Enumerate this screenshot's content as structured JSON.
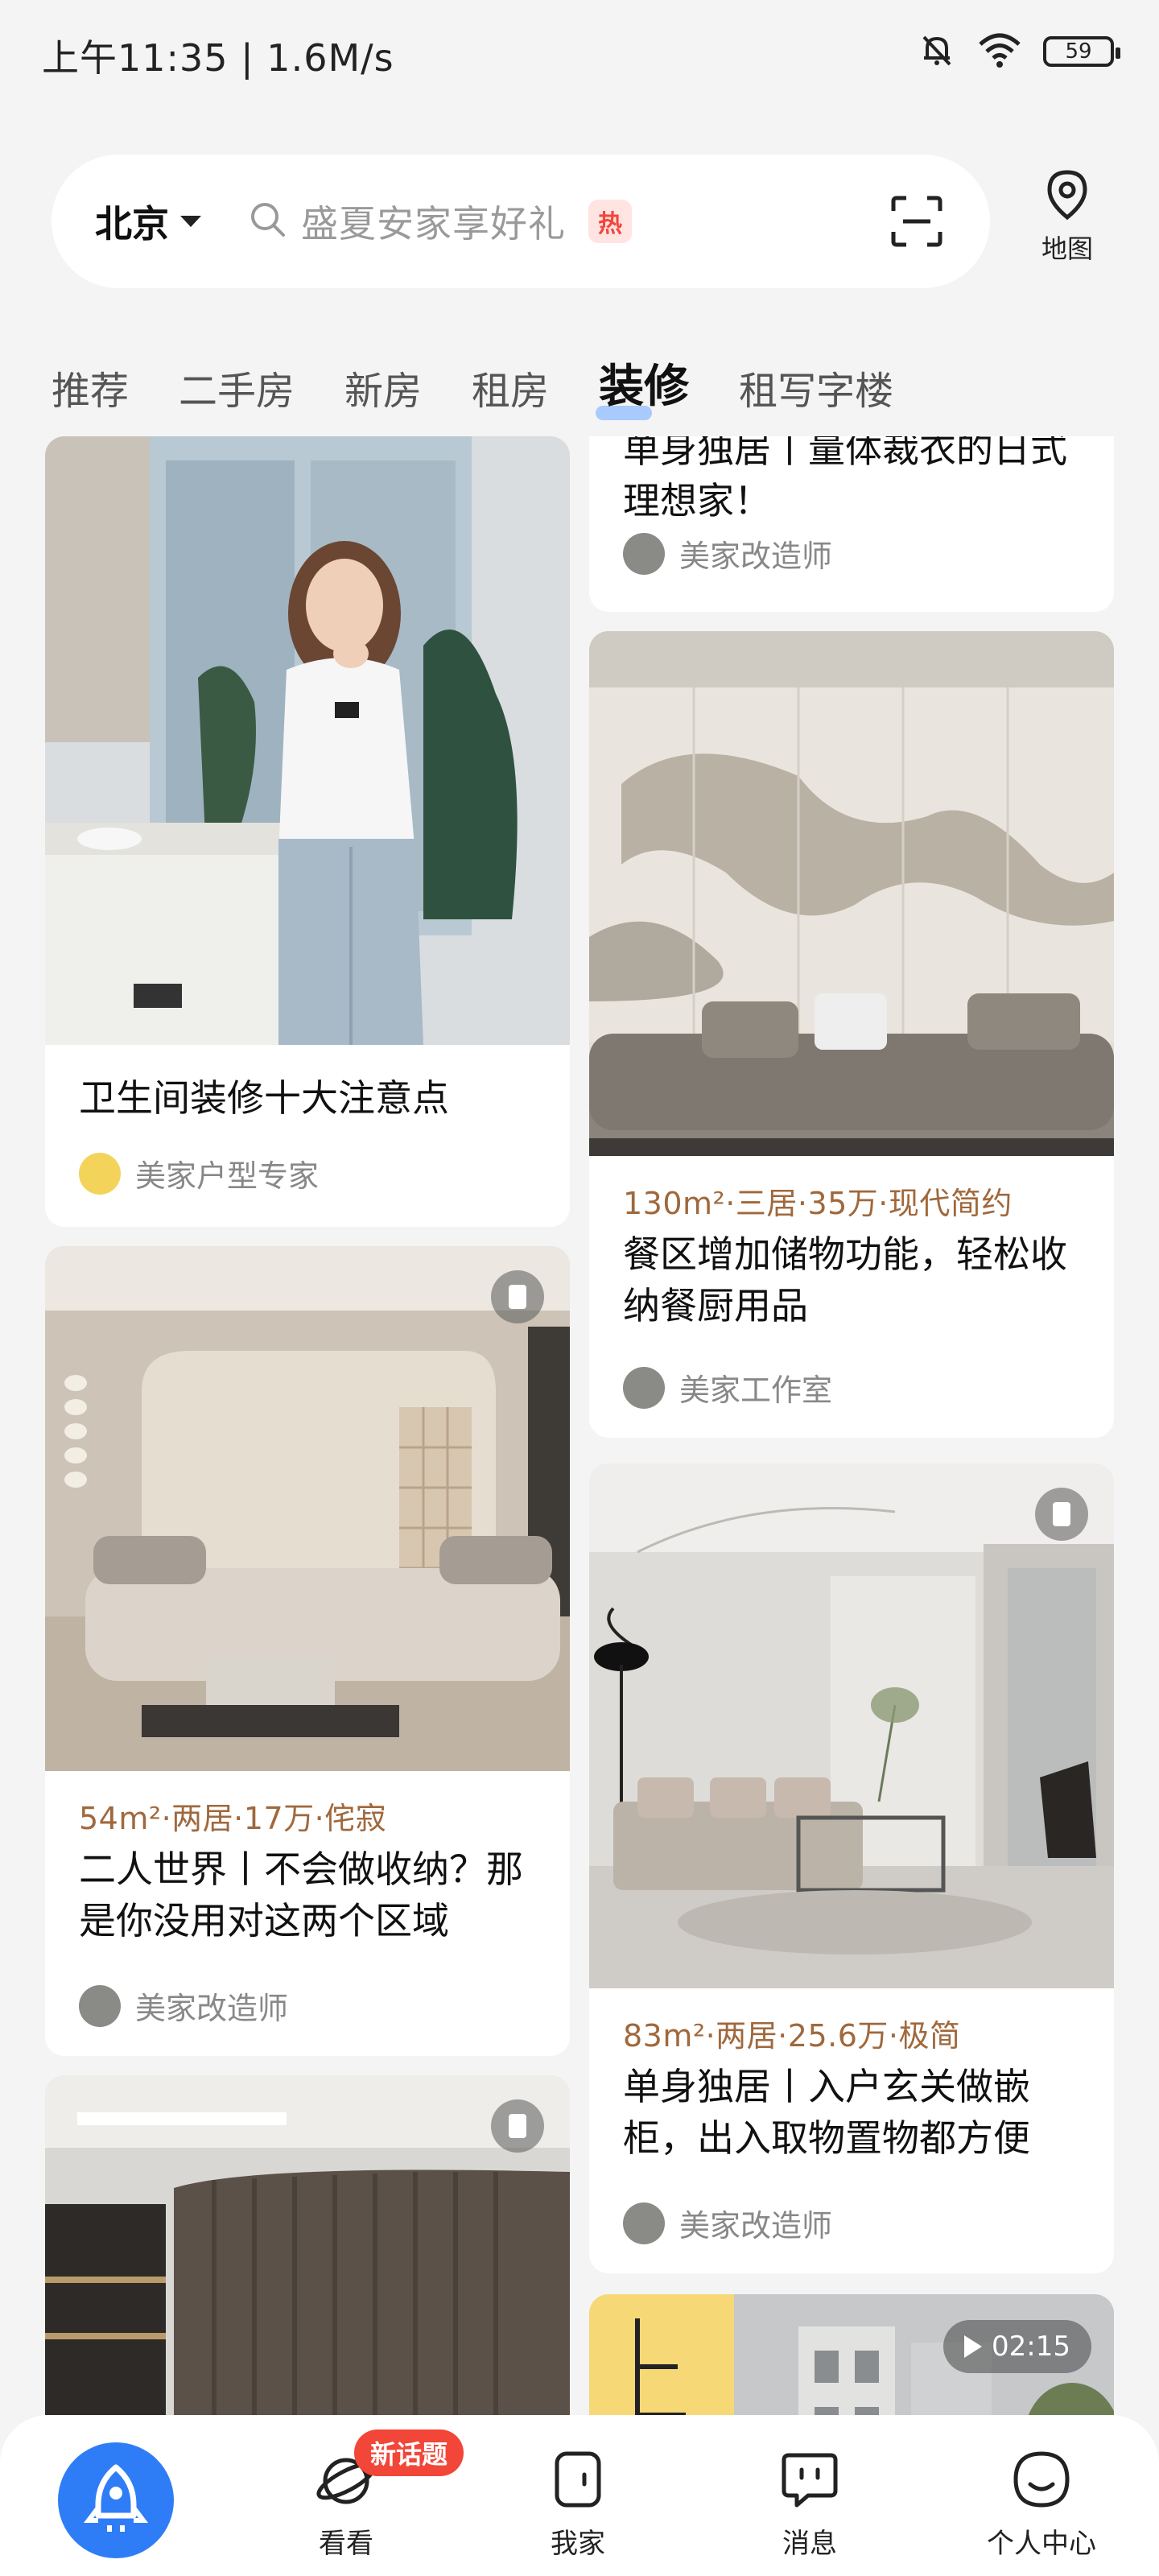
{
  "status_bar": {
    "time": "上午11:35 | 1.6M/s",
    "battery": "59"
  },
  "header": {
    "city": "北京",
    "search_placeholder": "盛夏安家享好礼",
    "hot_tag": "热",
    "map_label": "地图"
  },
  "tabs": [
    {
      "label": "推荐"
    },
    {
      "label": "二手房"
    },
    {
      "label": "新房"
    },
    {
      "label": "租房"
    },
    {
      "label": "装修",
      "active": true
    },
    {
      "label": "租写字楼"
    }
  ],
  "feed": {
    "left": [
      {
        "title": "卫生间装修十大注意点",
        "author": "美家户型专家"
      },
      {
        "meta": "54m²·两居·17万·侘寂",
        "title": "二人世界丨不会做收纳？那是你没用对这两个区域",
        "author": "美家改造师"
      },
      {}
    ],
    "right": [
      {
        "title": "单身独居丨量体裁衣的日式理想家！",
        "author": "美家改造师"
      },
      {
        "meta": "130m²·三居·35万·现代简约",
        "title": "餐区增加储物功能，轻松收纳餐厨用品",
        "author": "美家工作室"
      },
      {
        "meta": "83m²·两居·25.6万·极简",
        "title": "单身独居丨入户玄关做嵌柜，出入取物置物都方便",
        "author": "美家改造师"
      },
      {
        "duration": "02:15"
      }
    ]
  },
  "bottom_nav": {
    "new_topic_badge": "新话题",
    "items": [
      {
        "label": "看看"
      },
      {
        "label": "我家"
      },
      {
        "label": "消息"
      },
      {
        "label": "个人中心"
      }
    ]
  },
  "colors": {
    "accent": "#2f7df6",
    "meta_text": "#a0683c",
    "hot": "#f2463d"
  }
}
